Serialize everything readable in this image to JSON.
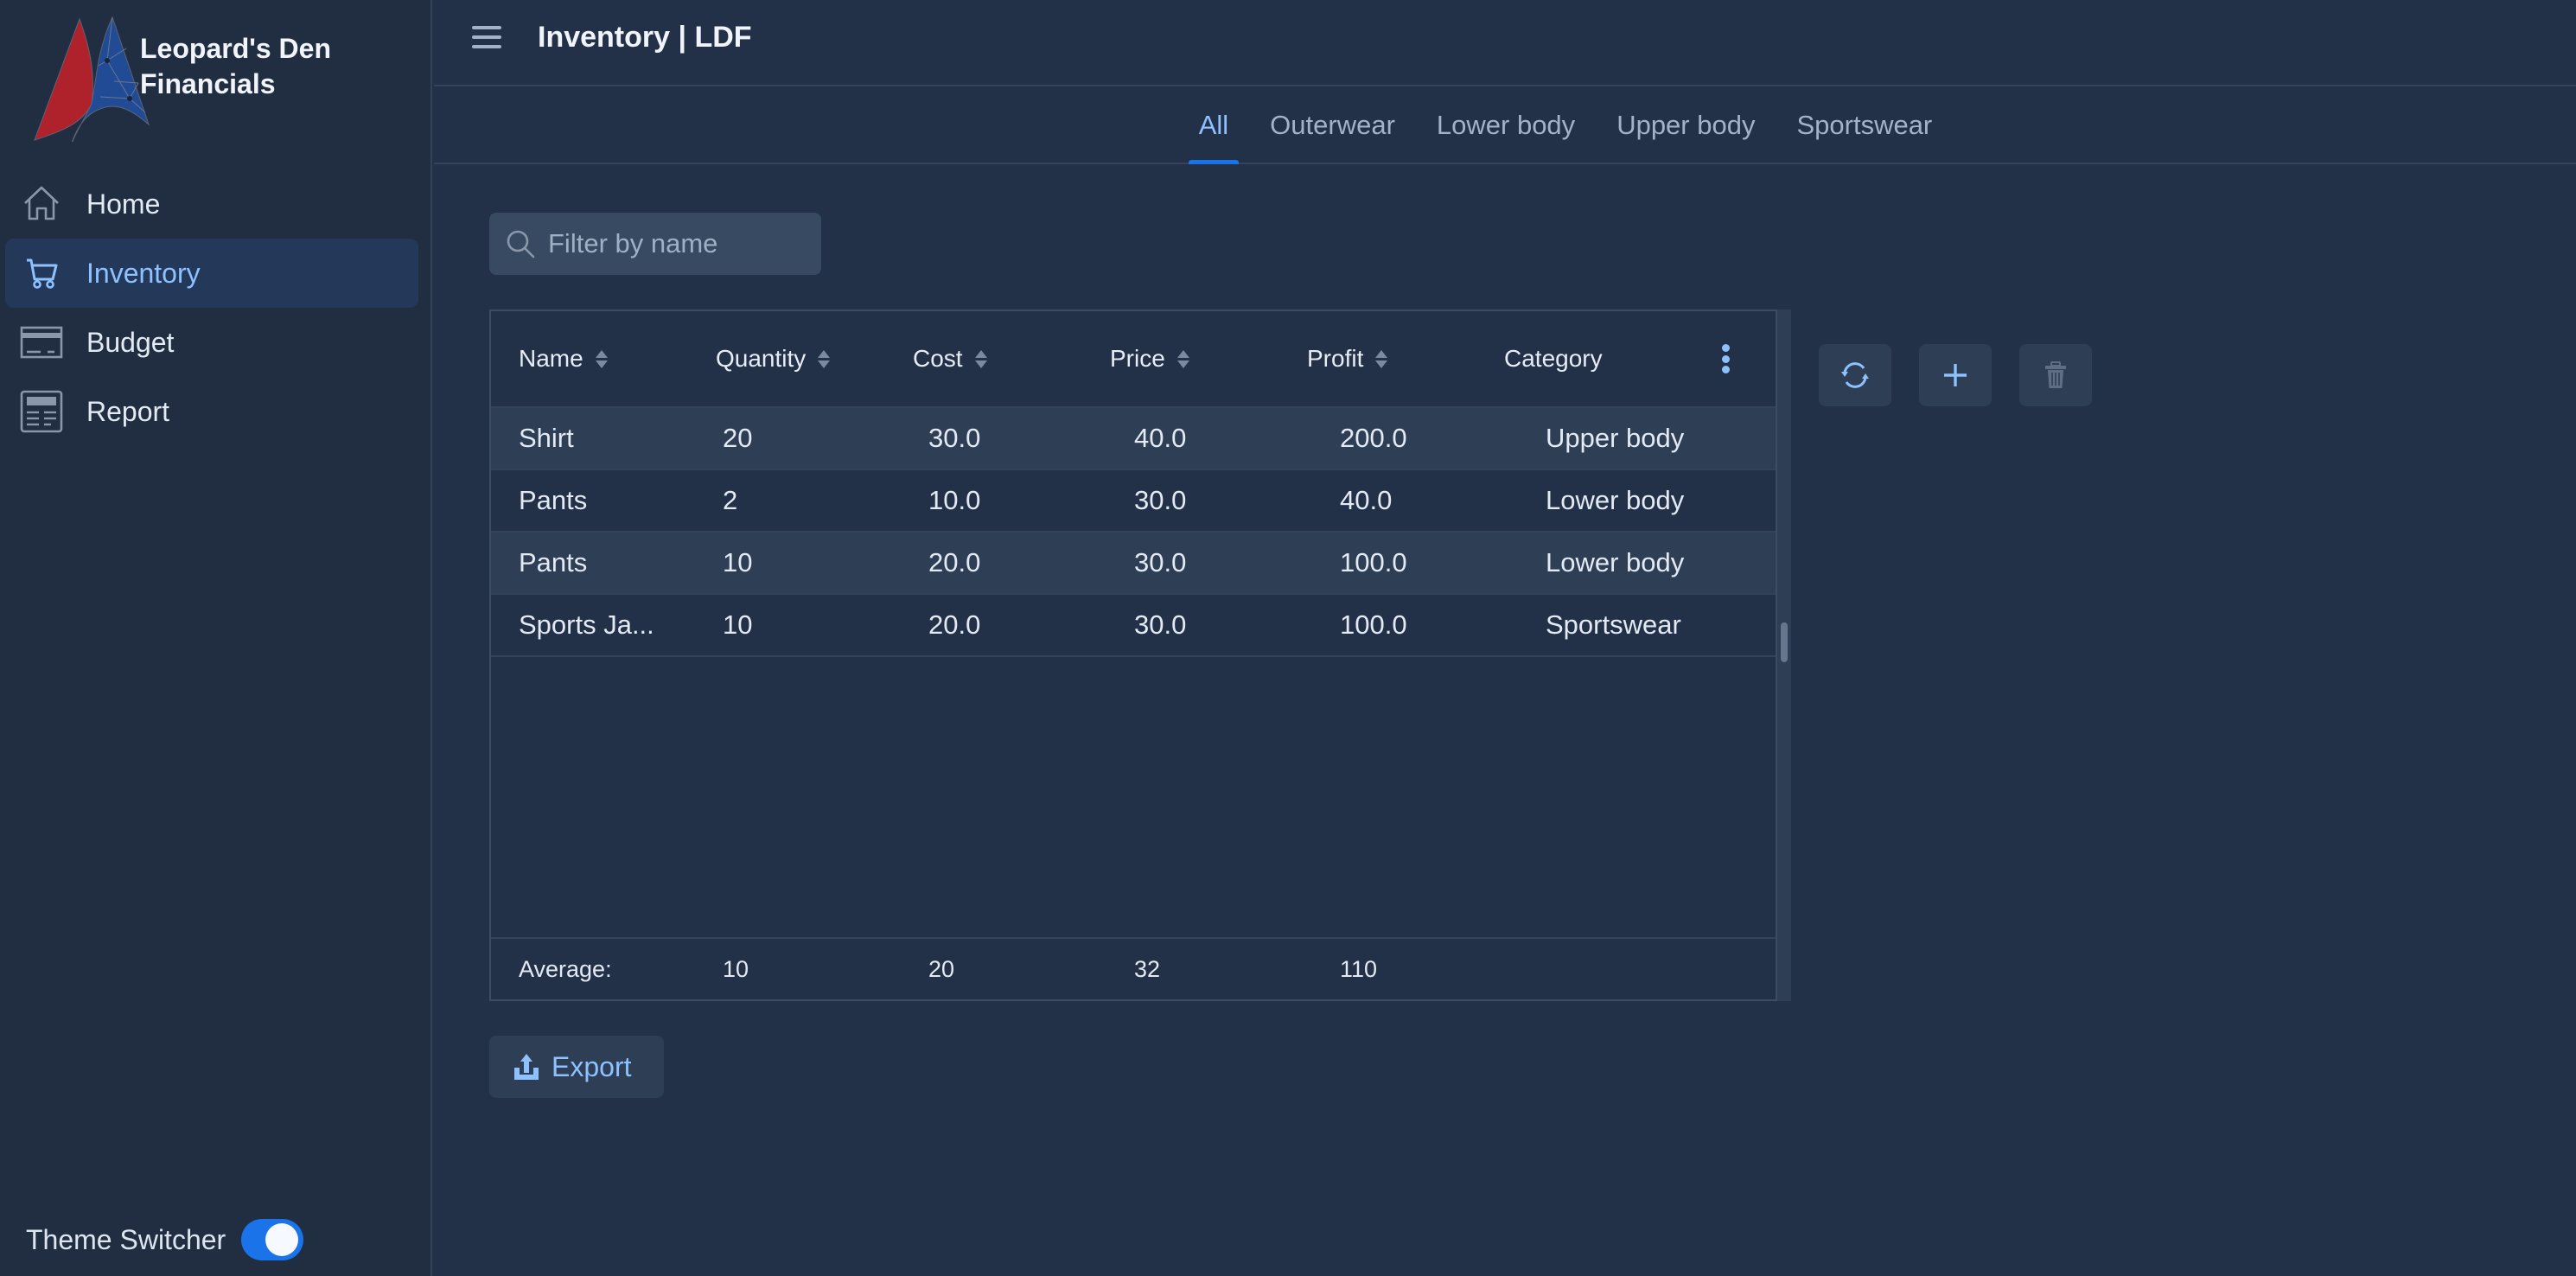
{
  "brand": {
    "name": "Leopard's Den Financials",
    "colors": {
      "red": "#b0222b",
      "blue": "#224b95"
    }
  },
  "sidebar": {
    "items": [
      {
        "label": "Home",
        "icon": "home-icon",
        "active": false
      },
      {
        "label": "Inventory",
        "icon": "cart-icon",
        "active": true
      },
      {
        "label": "Budget",
        "icon": "card-icon",
        "active": false
      },
      {
        "label": "Report",
        "icon": "newspaper-icon",
        "active": false
      }
    ],
    "theme_switcher": {
      "label": "Theme Switcher",
      "on": true
    }
  },
  "header": {
    "title": "Inventory | LDF",
    "menu_icon": "hamburger-icon"
  },
  "tabs": [
    {
      "label": "All",
      "active": true
    },
    {
      "label": "Outerwear",
      "active": false
    },
    {
      "label": "Lower body",
      "active": false
    },
    {
      "label": "Upper body",
      "active": false
    },
    {
      "label": "Sportswear",
      "active": false
    }
  ],
  "filter": {
    "placeholder": "Filter by name",
    "value": ""
  },
  "table": {
    "columns": [
      {
        "label": "Name",
        "sortable": true
      },
      {
        "label": "Quantity",
        "sortable": true
      },
      {
        "label": "Cost",
        "sortable": true
      },
      {
        "label": "Price",
        "sortable": true
      },
      {
        "label": "Profit",
        "sortable": true
      },
      {
        "label": "Category",
        "sortable": false
      }
    ],
    "rows": [
      {
        "name": "Shirt",
        "quantity": "20",
        "cost": "30.0",
        "price": "40.0",
        "profit": "200.0",
        "category": "Upper body"
      },
      {
        "name": "Pants",
        "quantity": "2",
        "cost": "10.0",
        "price": "30.0",
        "profit": "40.0",
        "category": "Lower body"
      },
      {
        "name": "Pants",
        "quantity": "10",
        "cost": "20.0",
        "price": "30.0",
        "profit": "100.0",
        "category": "Lower body"
      },
      {
        "name": "Sports Ja...",
        "quantity": "10",
        "cost": "20.0",
        "price": "30.0",
        "profit": "100.0",
        "category": "Sportswear"
      }
    ],
    "footer": {
      "label": "Average:",
      "quantity": "10",
      "cost": "20",
      "price": "32",
      "profit": "110"
    }
  },
  "actions": [
    {
      "name": "refresh-button",
      "icon": "refresh-icon",
      "enabled": true
    },
    {
      "name": "add-button",
      "icon": "plus-icon",
      "enabled": true
    },
    {
      "name": "delete-button",
      "icon": "trash-icon",
      "enabled": false
    }
  ],
  "export": {
    "label": "Export",
    "icon": "upload-icon"
  },
  "colors": {
    "background": "#223048",
    "sidebar": "#212e42",
    "accent": "#1a73e8",
    "accent_text": "#8ec1ff"
  }
}
